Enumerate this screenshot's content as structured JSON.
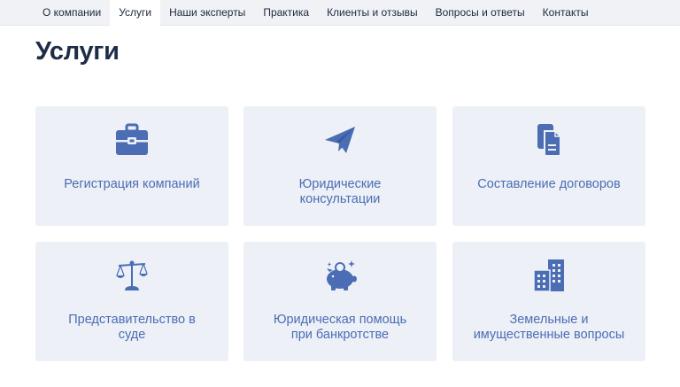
{
  "nav": {
    "items": [
      {
        "label": "О компании"
      },
      {
        "label": "Услуги"
      },
      {
        "label": "Наши эксперты"
      },
      {
        "label": "Практика"
      },
      {
        "label": "Клиенты и отзывы"
      },
      {
        "label": "Вопросы и ответы"
      },
      {
        "label": "Контакты"
      }
    ],
    "active_label": "Услуги"
  },
  "page": {
    "title": "Услуги"
  },
  "services": [
    {
      "icon": "briefcase-icon",
      "lines": [
        "Регистрация компаний"
      ]
    },
    {
      "icon": "paper-plane-icon",
      "lines": [
        "Юридические",
        "консультации"
      ]
    },
    {
      "icon": "documents-icon",
      "lines": [
        "Составление договоров"
      ]
    },
    {
      "icon": "scales-icon",
      "lines": [
        "Представительство в",
        "суде"
      ]
    },
    {
      "icon": "piggy-bank-icon",
      "lines": [
        "Юридическая помощь",
        "при банкротстве"
      ]
    },
    {
      "icon": "building-icon",
      "lines": [
        "Земельные и",
        "имущественные вопросы"
      ]
    }
  ],
  "colors": {
    "accent": "#4a6db4",
    "card_bg": "#edf0f7",
    "title": "#1e2d47",
    "nav_bg": "#f0f2f6"
  }
}
